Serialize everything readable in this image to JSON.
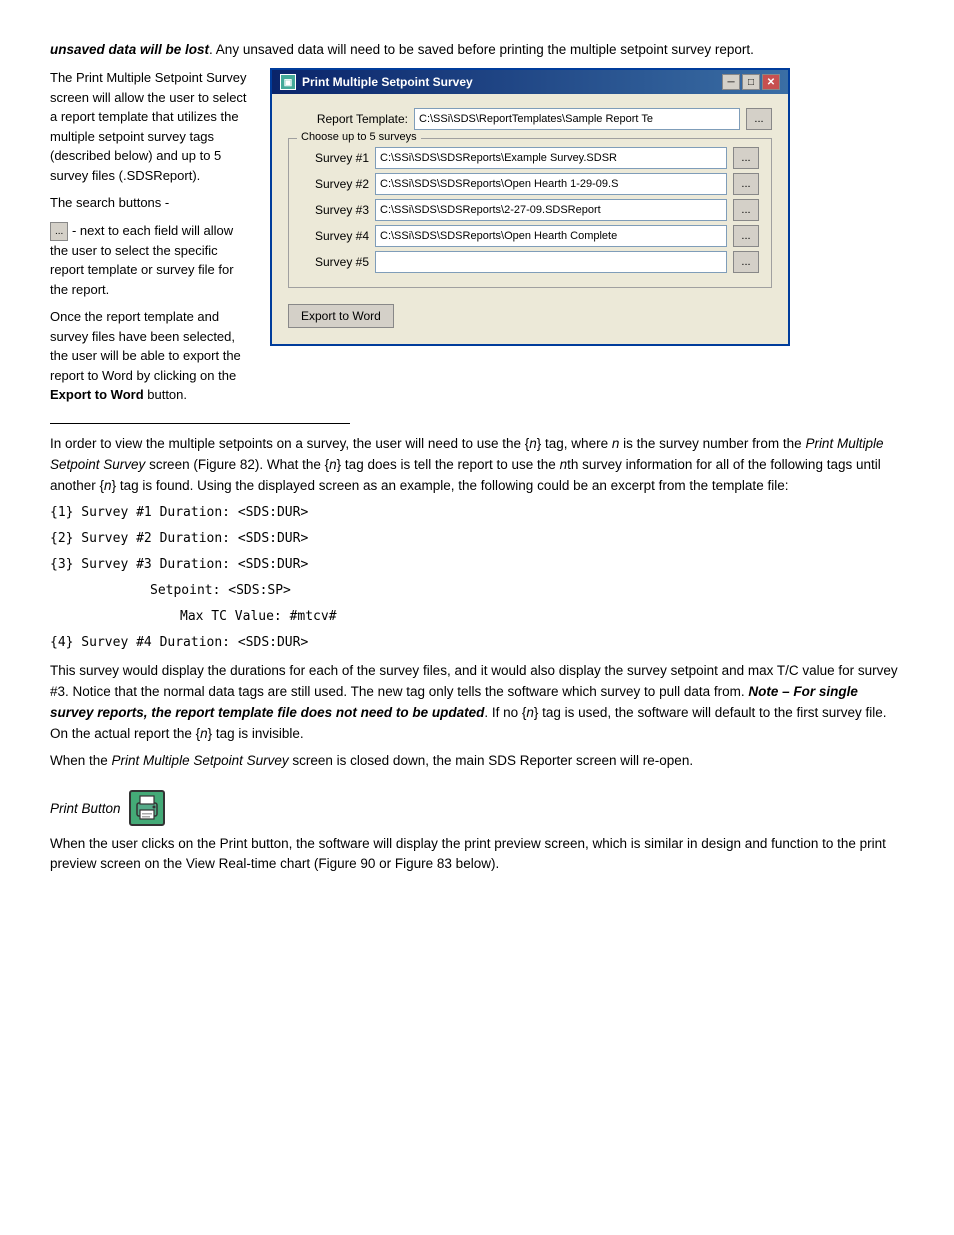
{
  "intro": {
    "bold_italic_text": "unsaved data will be lost",
    "line1_rest": ".  Any unsaved data will need to be saved before printing the multiple setpoint survey report.",
    "line2": "The Print Multiple Setpoint Survey screen will allow the user to select a report template that utilizes the multiple setpoint survey tags (described below) and up to 5 survey files (.SDSReport).",
    "search_buttons_label": "The search buttons -",
    "search_btn_label": "...",
    "left_col_text": " - next to each field will allow the user to select the specific report template or survey file for the report.\nOnce the report template and survey files have been selected, the user will be able to export the report to Word by clicking on the ",
    "export_bold": "Export to Word",
    "left_col_text2": " button."
  },
  "dialog": {
    "title": "Print Multiple Setpoint Survey",
    "min_btn": "─",
    "max_btn": "□",
    "close_btn": "✕",
    "report_template_label": "Report Template:",
    "report_template_value": "C:\\SSi\\SDS\\ReportTemplates\\Sample Report Te",
    "browse_label": "...",
    "group_label": "Choose up to 5 surveys",
    "surveys": [
      {
        "label": "Survey #1",
        "value": "C:\\SSi\\SDS\\SDSReports\\Example Survey.SDSR"
      },
      {
        "label": "Survey #2",
        "value": "C:\\SSi\\SDS\\SDSReports\\Open Hearth 1-29-09.S"
      },
      {
        "label": "Survey #3",
        "value": "C:\\SSi\\SDS\\SDSReports\\2-27-09.SDSReport"
      },
      {
        "label": "Survey #4",
        "value": "C:\\SSi\\SDS\\SDSReports\\Open Hearth Complete"
      },
      {
        "label": "Survey #5",
        "value": ""
      }
    ],
    "export_btn_label": "Export to Word"
  },
  "body_text": {
    "para1": "In order to view the multiple setpoints on a survey, the user will need to use the {",
    "n_tag": "n",
    "para1b": "} tag, where ",
    "n_italic": "n",
    "para1c": " is the survey number from the ",
    "screen_italic": "Print Multiple Setpoint Survey",
    "para1d": " screen (Figure 82).  What the {",
    "n_tag2": "n",
    "para1e": "} tag does is tell the report to use the ",
    "nth_italic": "n",
    "para1f": "th survey information for all of the following tags until another {",
    "n_tag3": "n",
    "para1g": "} tag is found.  Using the displayed screen as an example, the following could be an excerpt from the template file:",
    "code_lines": [
      "{1} Survey #1 Duration: <SDS:DUR>",
      "{2} Survey #2 Duration: <SDS:DUR>",
      "{3} Survey #3 Duration: <SDS:DUR>",
      "        Setpoint: <SDS:SP>",
      "               Max TC Value: #mtcv#",
      "{4} Survey #4 Duration: <SDS:DUR>"
    ],
    "para2": "This survey would display the durations for each of the survey files, and it would also display the survey setpoint and max T/C value for survey #3.  Notice that the normal data tags are still used.  The new tag only tells the software which survey to pull data from.  ",
    "note_bold_italic": "Note – For single survey reports, the report template file does not need to be updated",
    "para2b": ".  If no {",
    "n_tag4": "n",
    "para2c": "} tag is used, the software will default to the first survey file.  On the actual report the {",
    "n_tag5": "n",
    "para2d": "} tag is invisible.",
    "para3_pre": "When the ",
    "para3_italic": "Print Multiple Setpoint Survey",
    "para3_post": " screen is closed down, the main SDS Reporter screen will re-open.",
    "print_section_label": "Print Button",
    "print_para": "When the user clicks on the Print button, the software will display the print preview screen, which is similar in design and function to the print preview screen on the View Real-time chart (Figure 90 or Figure 83 below)."
  }
}
